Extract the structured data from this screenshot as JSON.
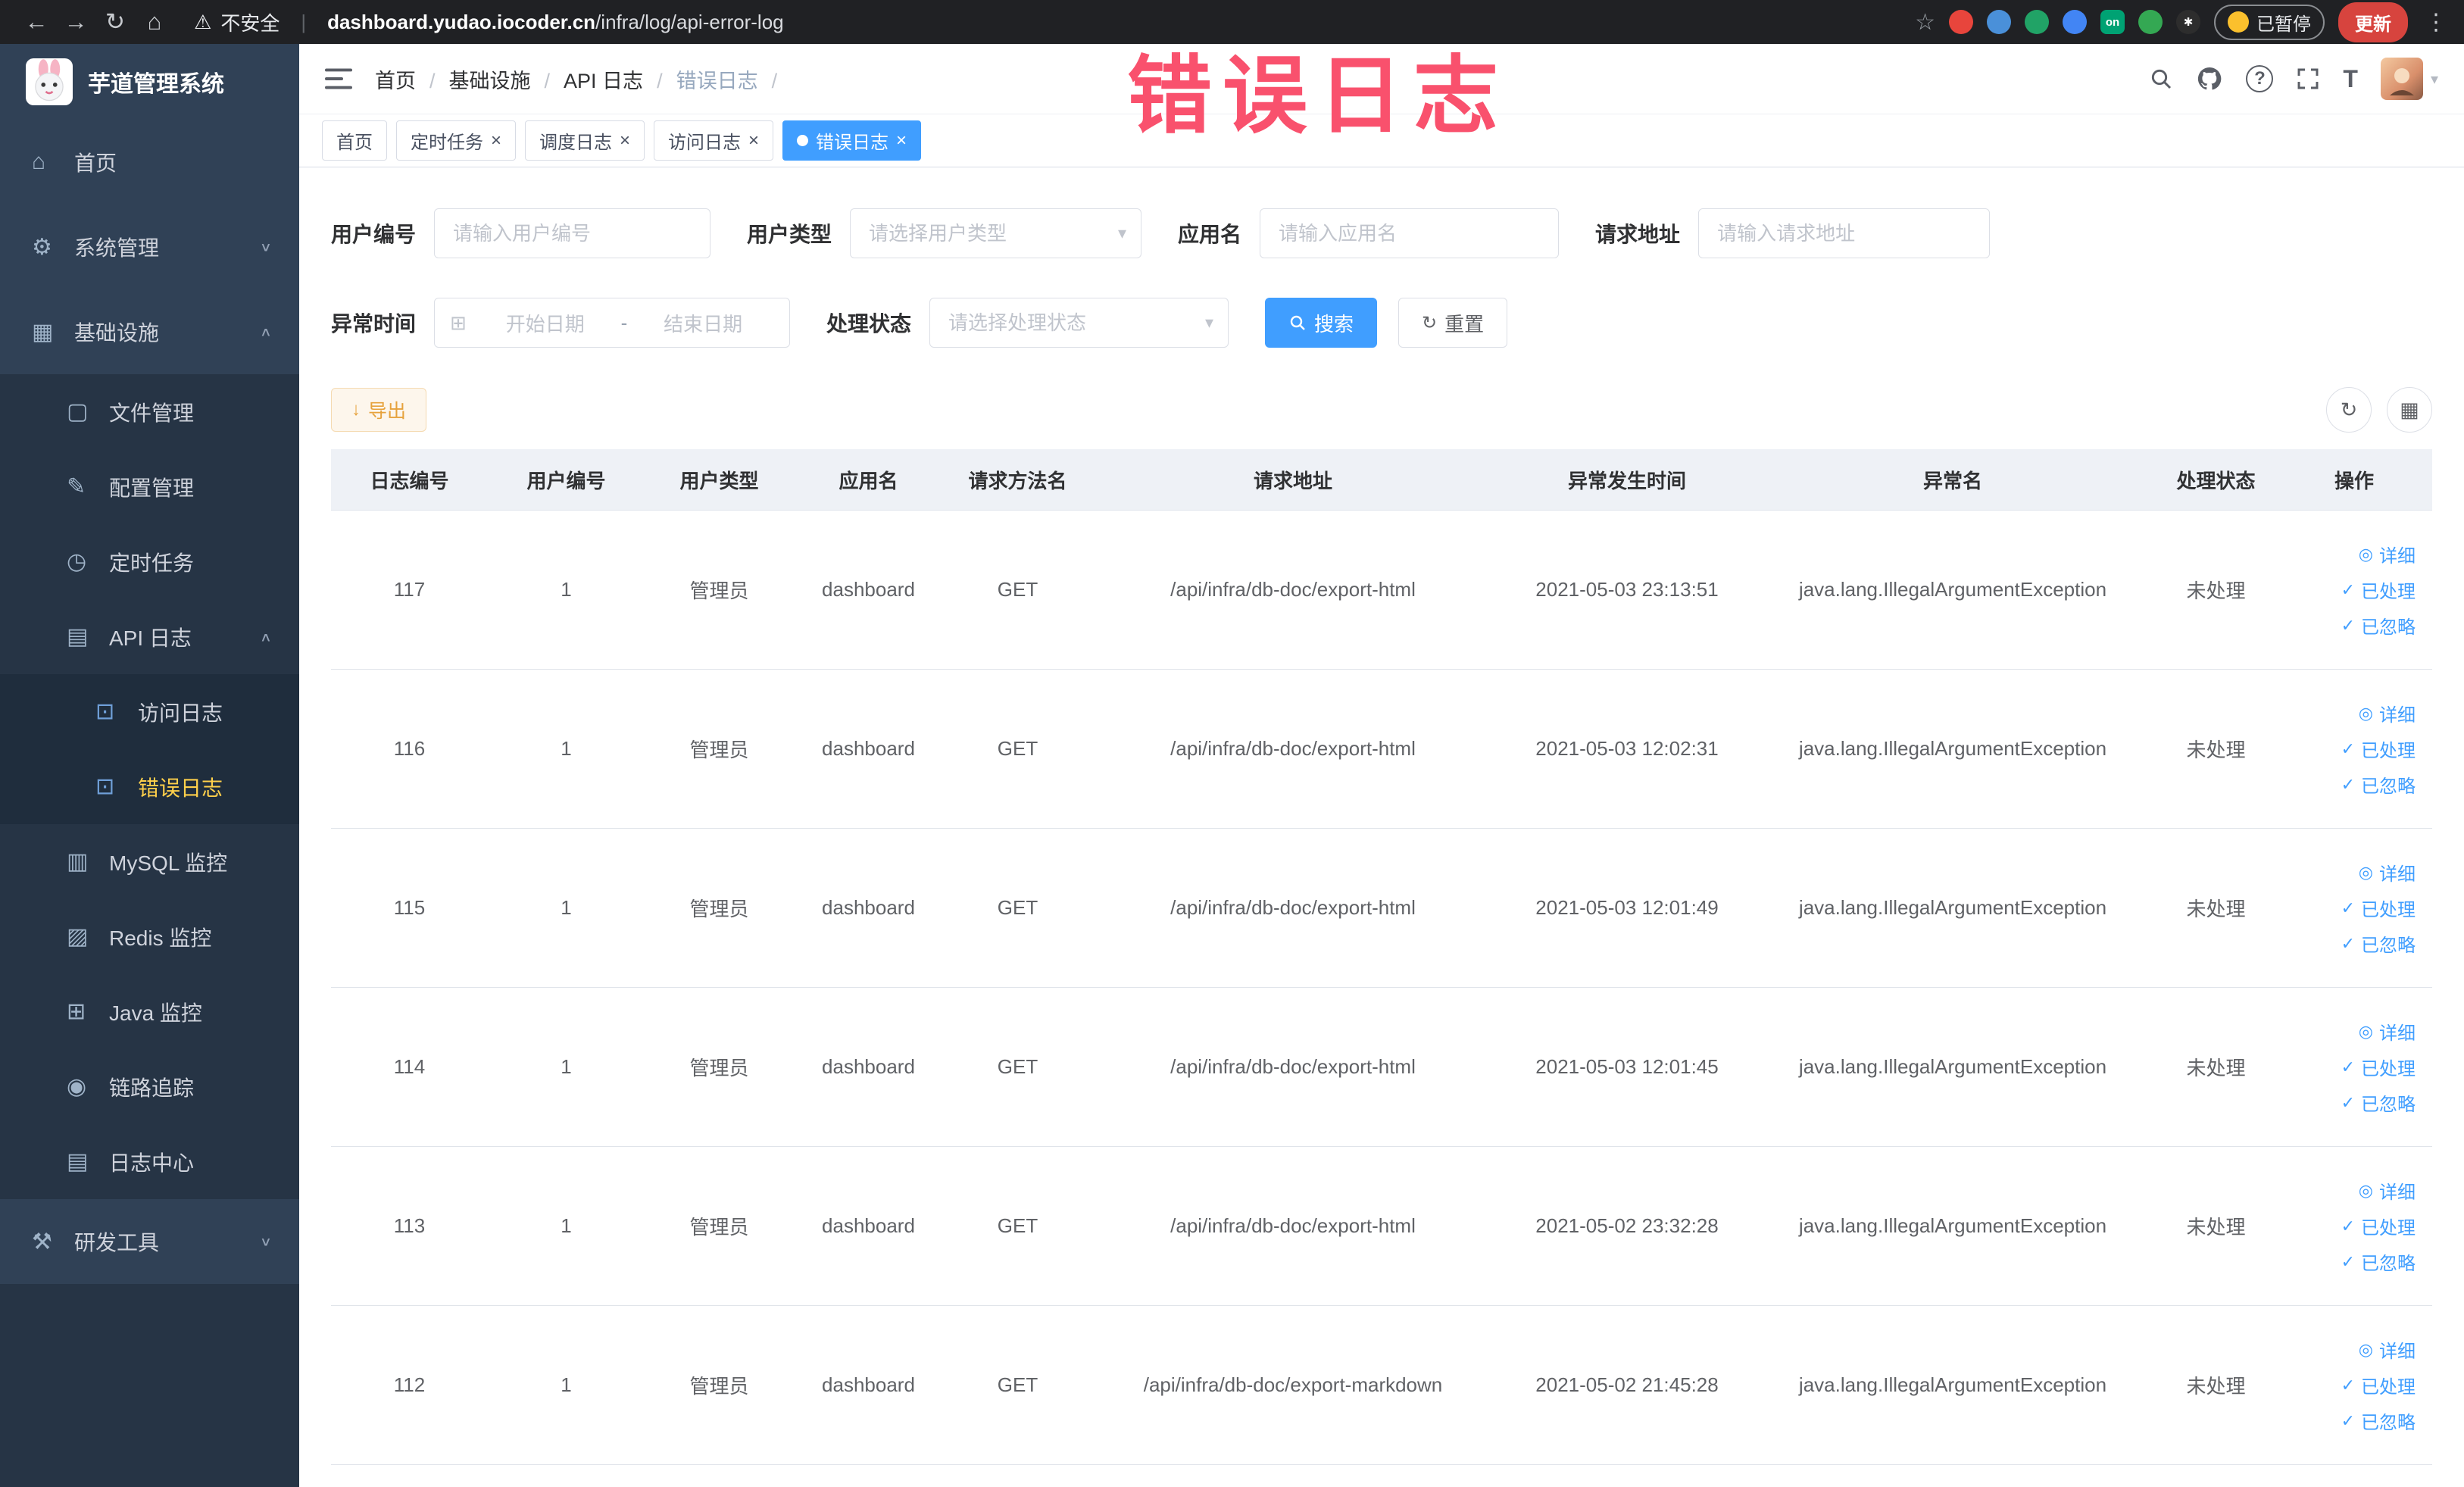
{
  "colors": {
    "accent": "#409eff",
    "sidebar_active": "#ffd04b",
    "watermark": "#f9516d",
    "warning": "#e6a23c",
    "chrome_bg": "#202124",
    "sidebar_bg": "#304156"
  },
  "icons": {
    "back": "←",
    "forward": "→",
    "reload": "↻",
    "home-nav": "⌂",
    "warning": "⚠",
    "star": "☆",
    "more": "⋮",
    "close": "×",
    "caret": "▾",
    "home": "⌂",
    "system": "⚙",
    "infra": "▦",
    "file": "▢",
    "config": "✎",
    "job": "◷",
    "api-log": "▤",
    "access-log": "⊡",
    "error-log": "⊡",
    "mysql": "▥",
    "redis": "▨",
    "java": "⊞",
    "trace": "◉",
    "log-center": "▤",
    "tools": "⚒",
    "arrow-down": "∨",
    "arrow-up": "∧",
    "calendar": "⊞",
    "download": "↓",
    "refresh": "↻",
    "columns": "▦",
    "eye": "◎",
    "check": "✓"
  },
  "browser": {
    "security_label": "不安全",
    "url_domain": "dashboard.yudao.iocoder.cn",
    "url_path": "/infra/log/api-error-log",
    "extension_on_label": "on",
    "paused_badge": "已暂停",
    "update_button": "更新"
  },
  "watermark": "错误日志",
  "sidebar": {
    "logo_title": "芋道管理系统",
    "items": [
      {
        "label": "首页",
        "icon": "home",
        "level": 1
      },
      {
        "label": "系统管理",
        "icon": "system",
        "level": 1,
        "arrow": "arrow-down"
      },
      {
        "label": "基础设施",
        "icon": "infra",
        "level": 1,
        "arrow": "arrow-up"
      },
      {
        "label": "文件管理",
        "icon": "file",
        "level": 2
      },
      {
        "label": "配置管理",
        "icon": "config",
        "level": 2
      },
      {
        "label": "定时任务",
        "icon": "job",
        "level": 2
      },
      {
        "label": "API 日志",
        "icon": "api-log",
        "level": 2,
        "arrow": "arrow-up"
      },
      {
        "label": "访问日志",
        "icon": "access-log",
        "level": 3
      },
      {
        "label": "错误日志",
        "icon": "error-log",
        "level": 3,
        "active": true
      },
      {
        "label": "MySQL 监控",
        "icon": "mysql",
        "level": 2
      },
      {
        "label": "Redis 监控",
        "icon": "redis",
        "level": 2
      },
      {
        "label": "Java 监控",
        "icon": "java",
        "level": 2
      },
      {
        "label": "链路追踪",
        "icon": "trace",
        "level": 2
      },
      {
        "label": "日志中心",
        "icon": "log-center",
        "level": 2
      },
      {
        "label": "研发工具",
        "icon": "tools",
        "level": 1,
        "arrow": "arrow-down"
      }
    ]
  },
  "header": {
    "breadcrumbs": [
      {
        "label": "首页"
      },
      {
        "label": "基础设施"
      },
      {
        "label": "API 日志"
      },
      {
        "label": "错误日志",
        "current": true
      }
    ]
  },
  "tabs": [
    {
      "label": "首页",
      "closable": false
    },
    {
      "label": "定时任务",
      "closable": true
    },
    {
      "label": "调度日志",
      "closable": true
    },
    {
      "label": "访问日志",
      "closable": true
    },
    {
      "label": "错误日志",
      "closable": true,
      "active": true
    }
  ],
  "filters": {
    "user_id_label": "用户编号",
    "user_id_placeholder": "请输入用户编号",
    "user_type_label": "用户类型",
    "user_type_placeholder": "请选择用户类型",
    "app_name_label": "应用名",
    "app_name_placeholder": "请输入应用名",
    "request_url_label": "请求地址",
    "request_url_placeholder": "请输入请求地址",
    "exception_time_label": "异常时间",
    "start_placeholder": "开始日期",
    "range_separator": "-",
    "end_placeholder": "结束日期",
    "process_status_label": "处理状态",
    "process_status_placeholder": "请选择处理状态",
    "search_button": "搜索",
    "reset_button": "重置"
  },
  "toolbar": {
    "export_button": "导出"
  },
  "table": {
    "columns": [
      "日志编号",
      "用户编号",
      "用户类型",
      "应用名",
      "请求方法名",
      "请求地址",
      "异常发生时间",
      "异常名",
      "处理状态",
      "操作"
    ],
    "row_actions": [
      "详细",
      "已处理",
      "已忽略"
    ],
    "rows": [
      {
        "id": "117",
        "user_id": "1",
        "user_type": "管理员",
        "app": "dashboard",
        "method": "GET",
        "url": "/api/infra/db-doc/export-html",
        "time": "2021-05-03 23:13:51",
        "exception": "java.lang.IllegalArgumentException",
        "status": "未处理"
      },
      {
        "id": "116",
        "user_id": "1",
        "user_type": "管理员",
        "app": "dashboard",
        "method": "GET",
        "url": "/api/infra/db-doc/export-html",
        "time": "2021-05-03 12:02:31",
        "exception": "java.lang.IllegalArgumentException",
        "status": "未处理"
      },
      {
        "id": "115",
        "user_id": "1",
        "user_type": "管理员",
        "app": "dashboard",
        "method": "GET",
        "url": "/api/infra/db-doc/export-html",
        "time": "2021-05-03 12:01:49",
        "exception": "java.lang.IllegalArgumentException",
        "status": "未处理"
      },
      {
        "id": "114",
        "user_id": "1",
        "user_type": "管理员",
        "app": "dashboard",
        "method": "GET",
        "url": "/api/infra/db-doc/export-html",
        "time": "2021-05-03 12:01:45",
        "exception": "java.lang.IllegalArgumentException",
        "status": "未处理"
      },
      {
        "id": "113",
        "user_id": "1",
        "user_type": "管理员",
        "app": "dashboard",
        "method": "GET",
        "url": "/api/infra/db-doc/export-html",
        "time": "2021-05-02 23:32:28",
        "exception": "java.lang.IllegalArgumentException",
        "status": "未处理"
      },
      {
        "id": "112",
        "user_id": "1",
        "user_type": "管理员",
        "app": "dashboard",
        "method": "GET",
        "url": "/api/infra/db-doc/export-markdown",
        "time": "2021-05-02 21:45:28",
        "exception": "java.lang.IllegalArgumentException",
        "status": "未处理"
      }
    ]
  }
}
